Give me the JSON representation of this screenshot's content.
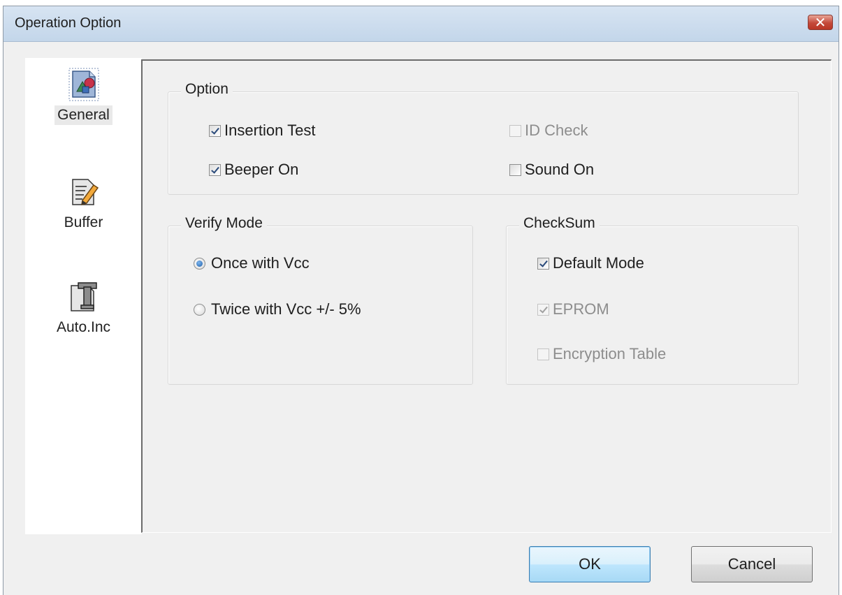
{
  "window": {
    "title": "Operation Option",
    "close_glyph": "✕"
  },
  "nav": {
    "items": [
      {
        "label": "General",
        "icon": "general-settings-icon",
        "selected": true
      },
      {
        "label": "Buffer",
        "icon": "buffer-edit-icon",
        "selected": false
      },
      {
        "label": "Auto.Inc",
        "icon": "auto-inc-icon",
        "selected": false
      }
    ]
  },
  "option_group": {
    "title": "Option",
    "insertion_test": {
      "label": "Insertion Test",
      "checked": true,
      "enabled": true
    },
    "id_check": {
      "label": "ID Check",
      "checked": false,
      "enabled": false
    },
    "beeper_on": {
      "label": "Beeper On",
      "checked": true,
      "enabled": true
    },
    "sound_on": {
      "label": "Sound On",
      "checked": false,
      "enabled": true
    }
  },
  "verify_mode": {
    "title": "Verify Mode",
    "options": [
      {
        "label": "Once with Vcc",
        "selected": true
      },
      {
        "label": "Twice with Vcc +/- 5%",
        "selected": false
      }
    ]
  },
  "checksum": {
    "title": "CheckSum",
    "default_mode": {
      "label": "Default Mode",
      "checked": true,
      "enabled": true
    },
    "eprom": {
      "label": "EPROM",
      "checked": true,
      "enabled": false
    },
    "encryption_table": {
      "label": "Encryption Table",
      "checked": false,
      "enabled": false
    }
  },
  "buttons": {
    "ok": "OK",
    "cancel": "Cancel"
  },
  "colors": {
    "title_bar": "#cddcee",
    "close_red": "#c4493a",
    "dialog_bg": "#f0f0f0",
    "radio_blue": "#1f5ea8"
  }
}
